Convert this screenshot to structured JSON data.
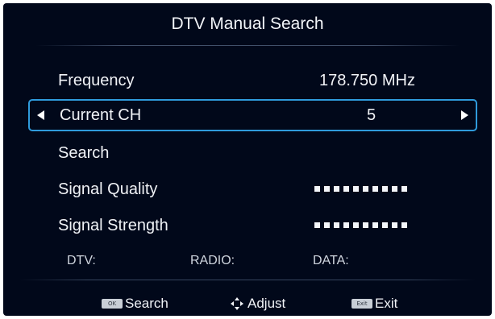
{
  "menu": {
    "title": "DTV Manual Search",
    "frequency": {
      "label": "Frequency",
      "value": "178.750 MHz"
    },
    "current_channel": {
      "label": "Current CH",
      "value": "5"
    },
    "search": {
      "label": "Search"
    },
    "signal_quality": {
      "label": "Signal Quality",
      "level_segments": 10
    },
    "signal_strength": {
      "label": "Signal Strength",
      "level_segments": 10
    }
  },
  "counts": {
    "dtv_label": "DTV:",
    "radio_label": "RADIO:",
    "data_label": "DATA:"
  },
  "footer": {
    "search_key": "OK",
    "search_label": "Search",
    "adjust_icon": "dpad-icon",
    "adjust_label": "Adjust",
    "exit_key": "Exit",
    "exit_label": "Exit"
  },
  "colors": {
    "background": "#01081a",
    "selection_border": "#2f9bdc",
    "text": "#f0f2f6"
  }
}
